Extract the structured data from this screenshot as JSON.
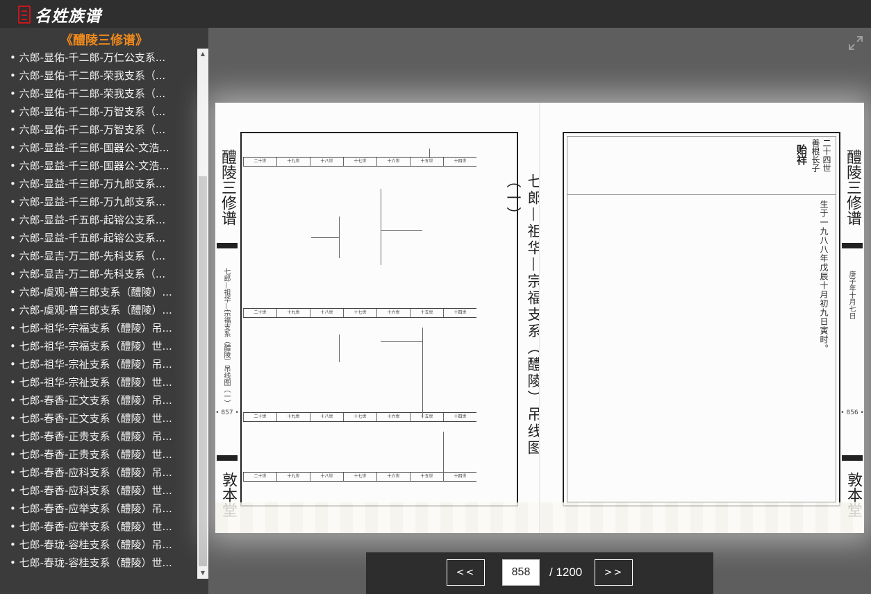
{
  "brand": {
    "logo_text": "名姓族谱"
  },
  "sidebar": {
    "book_title": "《醴陵三修谱》",
    "items": [
      "六郎-显佑-千二郎-万仁公支系...",
      "六郎-显佑-千二郎-荣我支系（...",
      "六郎-显佑-千二郎-荣我支系（...",
      "六郎-显佑-千二郎-万智支系（...",
      "六郎-显佑-千二郎-万智支系（...",
      "六郎-显益-千三郎-国器公-文浩...",
      "六郎-显益-千三郎-国器公-文浩...",
      "六郎-显益-千三郎-万九郎支系...",
      "六郎-显益-千三郎-万九郎支系...",
      "六郎-显益-千五郎-起镕公支系...",
      "六郎-显益-千五郎-起镕公支系...",
      "六郎-显吉-万二郎-先科支系（...",
      "六郎-显吉-万二郎-先科支系（...",
      "六郎-虞观-普三郎支系（醴陵）...",
      "六郎-虞观-普三郎支系（醴陵）...",
      "七郎-祖华-宗福支系（醴陵）吊...",
      "七郎-祖华-宗福支系（醴陵）世...",
      "七郎-祖华-宗祉支系（醴陵）吊...",
      "七郎-祖华-宗祉支系（醴陵）世...",
      "七郎-春香-正文支系（醴陵）吊...",
      "七郎-春香-正文支系（醴陵）世...",
      "七郎-春香-正贵支系（醴陵）吊...",
      "七郎-春香-正贵支系（醴陵）世...",
      "七郎-春香-应科支系（醴陵）吊...",
      "七郎-春香-应科支系（醴陵）世...",
      "七郎-春香-应举支系（醴陵）吊...",
      "七郎-春香-应举支系（醴陵）世...",
      "七郎-春珑-容桂支系（醴陵）吊...",
      "七郎-春珑-容桂支系（醴陵）世..."
    ]
  },
  "book": {
    "left_page": {
      "margin_title": "醴陵三修谱",
      "margin_subtitle": "七郎—祖华—宗福支系（醴陵）吊线图（一）",
      "page_number": "• 857 •",
      "hall_name": "敦本堂",
      "chart_title": "七郎—祖华—宗福支系（醴陵）吊线图（一）",
      "generation_labels": [
        "二十世",
        "十九世",
        "十八世",
        "十七世",
        "十六世",
        "十五世",
        "十四世"
      ]
    },
    "right_page": {
      "generation": "二十四世",
      "relation": "善根长子",
      "name": "贻祥",
      "birth_record": "生于一九八八年戊辰十月初九日寅时。",
      "margin_title": "醴陵三修谱",
      "margin_date": "庚子年十月七日",
      "page_number": "• 856 •",
      "hall_name": "敦本堂"
    }
  },
  "pager": {
    "prev_label": "<<",
    "next_label": ">>",
    "current_page": "858",
    "total": "/ 1200"
  },
  "colors": {
    "accent": "#f08a1c",
    "brand_red": "#c8161d",
    "topbar": "#2f2f2f",
    "sidebar": "#3b3b3b"
  }
}
